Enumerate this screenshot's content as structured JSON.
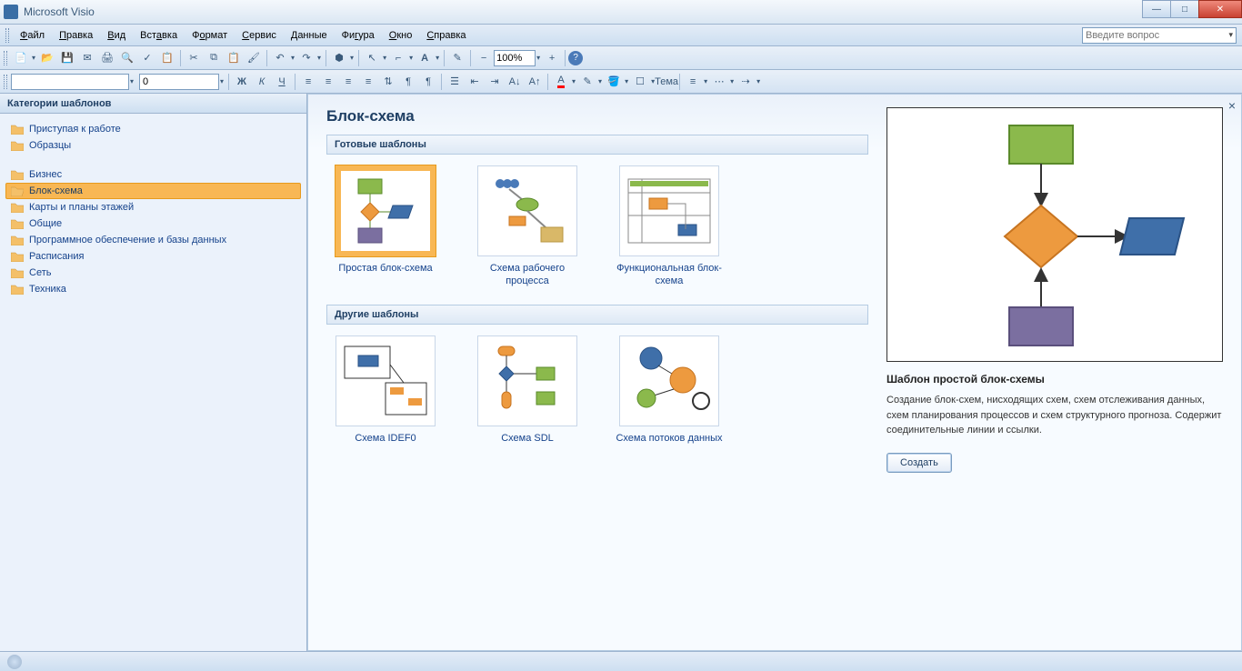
{
  "app_title": "Microsoft Visio",
  "menu": [
    "Файл",
    "Правка",
    "Вид",
    "Вставка",
    "Формат",
    "Сервис",
    "Данные",
    "Фигура",
    "Окно",
    "Справка"
  ],
  "ask_placeholder": "Введите вопрос",
  "zoom": "100%",
  "font_size_field": "0",
  "theme_label": "Тема",
  "sidebar": {
    "header": "Категории шаблонов",
    "group1": [
      {
        "label": "Приступая к работе"
      },
      {
        "label": "Образцы"
      }
    ],
    "group2": [
      {
        "label": "Бизнес"
      },
      {
        "label": "Блок-схема",
        "selected": true
      },
      {
        "label": "Карты и планы этажей"
      },
      {
        "label": "Общие"
      },
      {
        "label": "Программное обеспечение и базы данных"
      },
      {
        "label": "Расписания"
      },
      {
        "label": "Сеть"
      },
      {
        "label": "Техника"
      }
    ]
  },
  "gallery": {
    "title": "Блок-схема",
    "section1": "Готовые шаблоны",
    "section2": "Другие шаблоны",
    "thumbs1": [
      {
        "label": "Простая блок-схема",
        "selected": true
      },
      {
        "label": "Схема рабочего процесса"
      },
      {
        "label": "Функциональная блок-схема"
      }
    ],
    "thumbs2": [
      {
        "label": "Схема IDEF0"
      },
      {
        "label": "Схема SDL"
      },
      {
        "label": "Схема потоков данных"
      }
    ]
  },
  "preview": {
    "title": "Шаблон простой блок-схемы",
    "desc": "Создание блок-схем, нисходящих схем, схем отслеживания данных, схем планирования процессов и схем структурного прогноза. Содержит соединительные линии и ссылки.",
    "button": "Создать"
  }
}
